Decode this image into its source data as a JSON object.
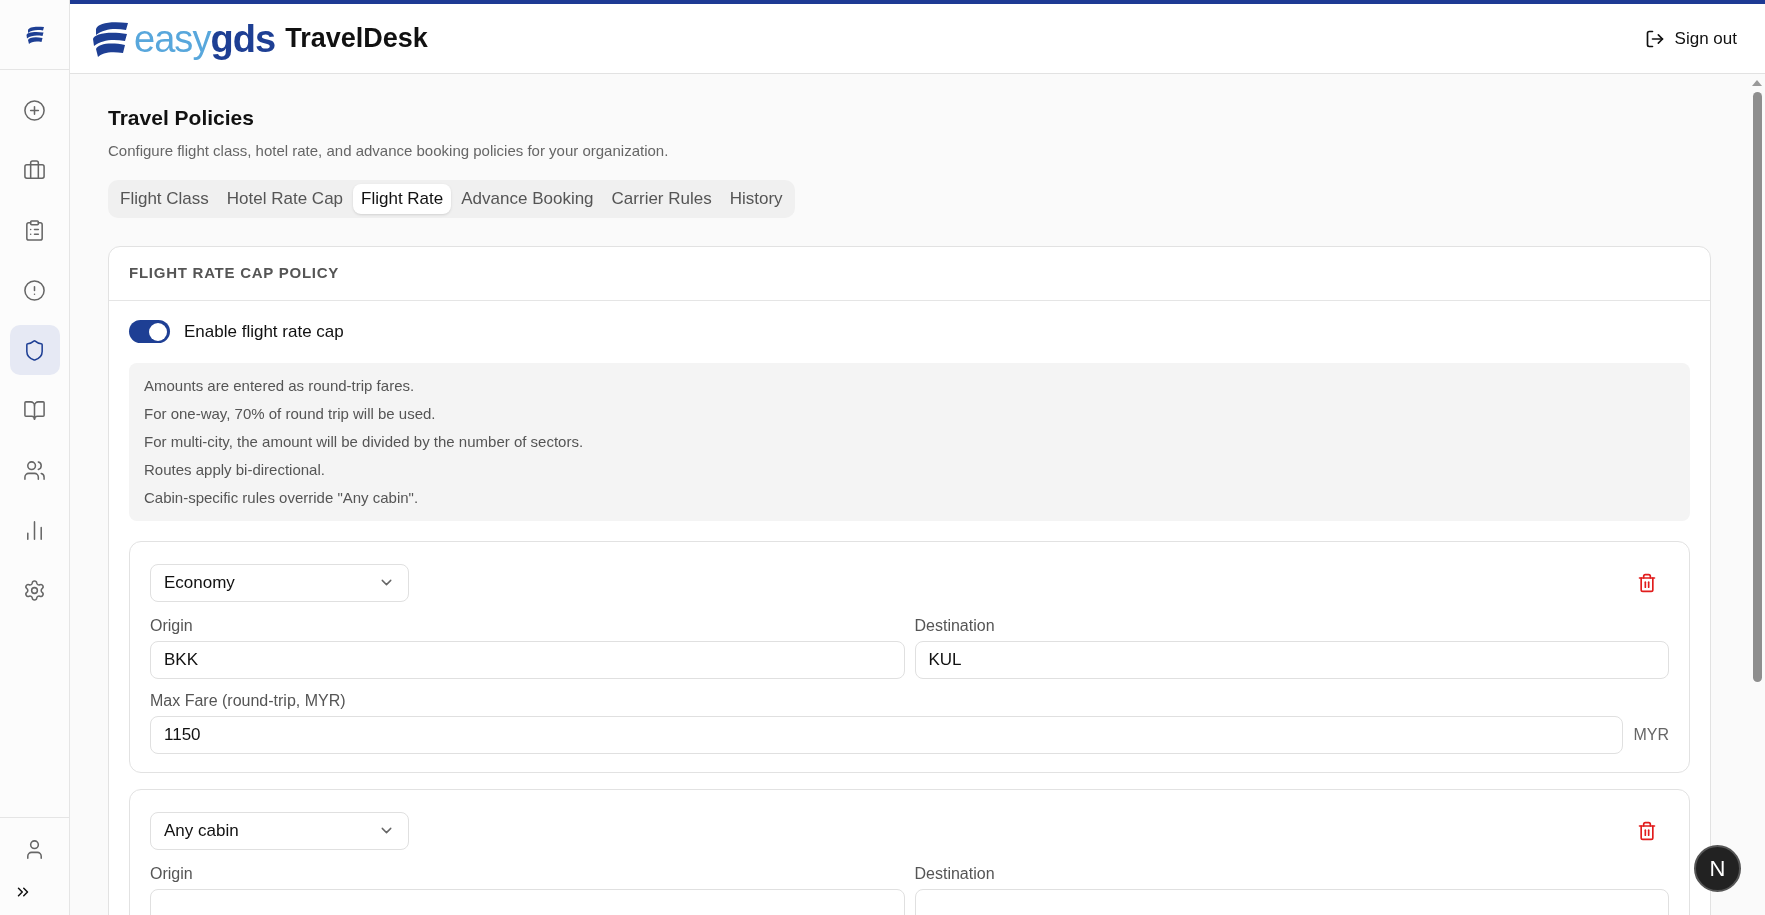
{
  "sidebar": {
    "items": [
      {
        "selected": false
      },
      {
        "selected": false
      },
      {
        "selected": false
      },
      {
        "selected": false
      },
      {
        "selected": true
      },
      {
        "selected": false
      },
      {
        "selected": false
      },
      {
        "selected": false
      },
      {
        "selected": false
      }
    ]
  },
  "header": {
    "logo_light": "easy",
    "logo_bold": "gds",
    "product": "TravelDesk",
    "sign_out": "Sign out"
  },
  "page": {
    "title": "Travel Policies",
    "subtitle": "Configure flight class, hotel rate, and advance booking policies for your organization."
  },
  "tabs": [
    {
      "label": "Flight Class",
      "selected": false
    },
    {
      "label": "Hotel Rate Cap",
      "selected": false
    },
    {
      "label": "Flight Rate",
      "selected": true
    },
    {
      "label": "Advance Booking",
      "selected": false
    },
    {
      "label": "Carrier Rules",
      "selected": false
    },
    {
      "label": "History",
      "selected": false
    }
  ],
  "policy": {
    "heading": "FLIGHT RATE CAP POLICY",
    "toggle": {
      "label": "Enable flight rate cap",
      "on": true
    },
    "notes": [
      "Amounts are entered as round-trip fares.",
      "For one-way, 70% of round trip will be used.",
      "For multi-city, the amount will be divided by the number of sectors.",
      "Routes apply bi-directional.",
      "Cabin-specific rules override \"Any cabin\"."
    ],
    "rules": [
      {
        "cabin": "Economy",
        "origin_label": "Origin",
        "origin": "BKK",
        "destination_label": "Destination",
        "destination": "KUL",
        "fare_label": "Max Fare (round-trip, MYR)",
        "fare": "1150",
        "currency": "MYR"
      },
      {
        "cabin": "Any cabin",
        "origin_label": "Origin",
        "destination_label": "Destination"
      }
    ]
  },
  "dev_badge": {
    "label": "N"
  }
}
